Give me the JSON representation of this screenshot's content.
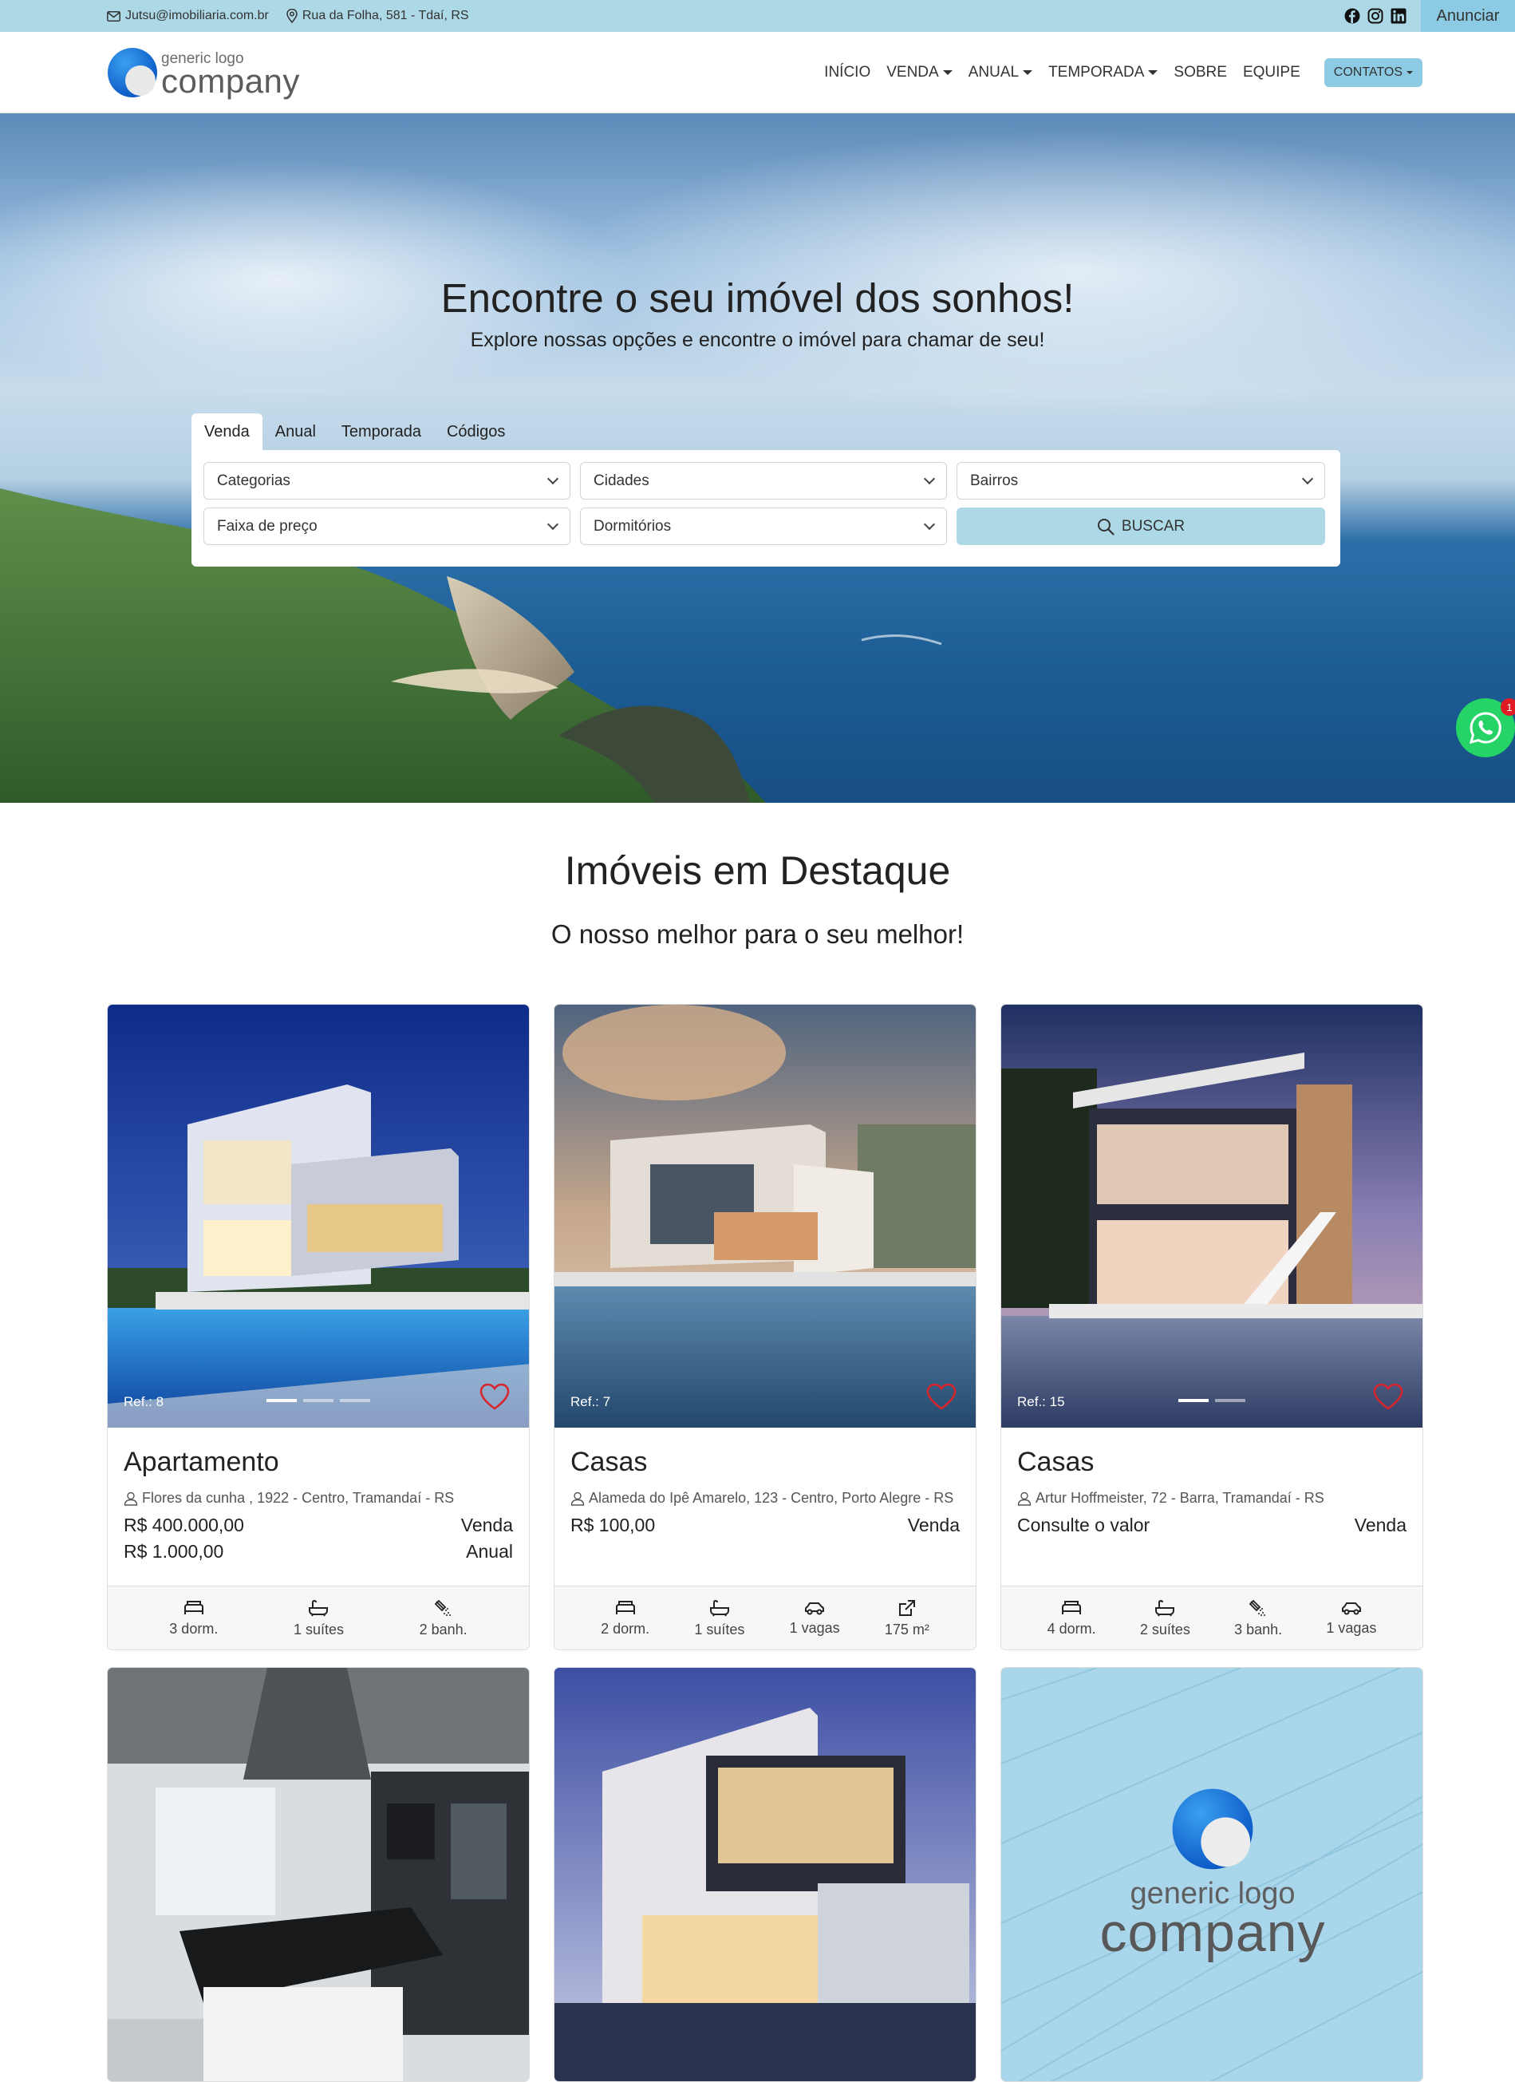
{
  "topbar": {
    "email": "Jutsu@imobiliaria.com.br",
    "address": "Rua da Folha, 581 - Tdaí, RS",
    "anunciar": "Anunciar"
  },
  "logo": {
    "small": "generic logo",
    "big": "company"
  },
  "nav": {
    "items": [
      {
        "label": "INÍCIO",
        "dropdown": false
      },
      {
        "label": "VENDA",
        "dropdown": true
      },
      {
        "label": "ANUAL",
        "dropdown": true
      },
      {
        "label": "TEMPORADA",
        "dropdown": true
      },
      {
        "label": "SOBRE",
        "dropdown": false
      },
      {
        "label": "EQUIPE",
        "dropdown": false
      }
    ],
    "contatos": "CONTATOS"
  },
  "hero": {
    "title": "Encontre o seu imóvel dos sonhos!",
    "subtitle": "Explore nossas opções e encontre o imóvel para chamar de seu!"
  },
  "search": {
    "tabs": [
      "Venda",
      "Anual",
      "Temporada",
      "Códigos"
    ],
    "active_tab": "Venda",
    "selects": [
      "Categorias",
      "Cidades",
      "Bairros",
      "Faixa de preço",
      "Dormitórios"
    ],
    "button": "BUSCAR"
  },
  "whatsapp": {
    "badge": "1"
  },
  "featured": {
    "title": "Imóveis em Destaque",
    "subtitle": "O nosso melhor para o seu melhor!"
  },
  "cards": [
    {
      "ref": "Ref.: 8",
      "type": "Apartamento",
      "address": "Flores da cunha , 1922 - Centro, Tramandaí - RS",
      "prices": [
        {
          "value": "R$ 400.000,00",
          "mode": "Venda"
        },
        {
          "value": "R$ 1.000,00",
          "mode": "Anual"
        }
      ],
      "features": [
        {
          "icon": "bed-icon",
          "label": "3 dorm."
        },
        {
          "icon": "bathtub-icon",
          "label": "1 suítes"
        },
        {
          "icon": "shower-icon",
          "label": "2 banh."
        }
      ],
      "dots": 3,
      "active_dot": 0
    },
    {
      "ref": "Ref.: 7",
      "type": "Casas",
      "address": "Alameda do Ipê Amarelo, 123 - Centro, Porto Alegre - RS",
      "prices": [
        {
          "value": "R$ 100,00",
          "mode": "Venda"
        }
      ],
      "features": [
        {
          "icon": "bed-icon",
          "label": "2 dorm."
        },
        {
          "icon": "bathtub-icon",
          "label": "1 suítes"
        },
        {
          "icon": "car-icon",
          "label": "1 vagas"
        },
        {
          "icon": "area-icon",
          "label": "175 m²"
        }
      ],
      "dots": 0,
      "active_dot": 0
    },
    {
      "ref": "Ref.: 15",
      "type": "Casas",
      "address": "Artur Hoffmeister, 72 - Barra, Tramandaí - RS",
      "prices": [
        {
          "value": "Consulte o valor",
          "mode": "Venda"
        }
      ],
      "features": [
        {
          "icon": "bed-icon",
          "label": "4 dorm."
        },
        {
          "icon": "bathtub-icon",
          "label": "2 suítes"
        },
        {
          "icon": "shower-icon",
          "label": "3 banh."
        },
        {
          "icon": "car-icon",
          "label": "1 vagas"
        }
      ],
      "dots": 2,
      "active_dot": 0
    }
  ],
  "placeholder_logo": {
    "small": "generic logo",
    "big": "company"
  }
}
